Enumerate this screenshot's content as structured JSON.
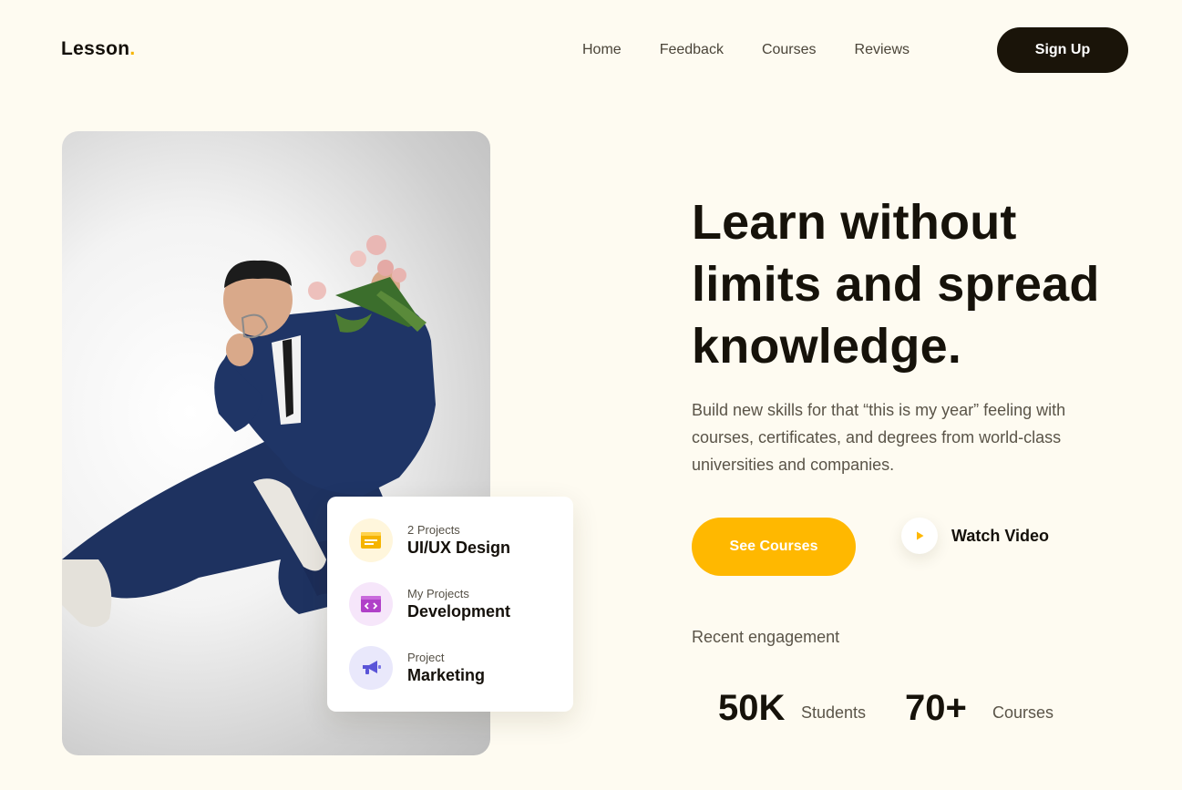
{
  "brand": {
    "name": "Lesson",
    "dot": ".",
    "accent": "#f5b400"
  },
  "nav": {
    "items": [
      "Home",
      "Feedback",
      "Courses",
      "Reviews"
    ],
    "signup_label": "Sign Up"
  },
  "card": {
    "items": [
      {
        "sub": "2 Projects",
        "main": "UI/UX Design",
        "icon": "window-icon",
        "color": "#f5b400",
        "bg": "#fff6dc"
      },
      {
        "sub": "My Projects",
        "main": "Development",
        "icon": "code-icon",
        "color": "#b040c8",
        "bg": "#f6e6fa"
      },
      {
        "sub": "Project",
        "main": "Marketing",
        "icon": "megaphone-icon",
        "color": "#5a54d8",
        "bg": "#e9e8fb"
      }
    ]
  },
  "hero": {
    "headline_1": "Learn without",
    "headline_2": "limits and spread",
    "headline_3": "knowledge.",
    "description": "Build new skills for that “this is my year” feeling with courses, certificates, and degrees from world-class universities and companies.",
    "primary_cta": "See Courses",
    "secondary_cta": "Watch Video"
  },
  "engagement": {
    "label": "Recent engagement",
    "stats": [
      {
        "value": "50K",
        "label": "Students"
      },
      {
        "value": "70+",
        "label": "Courses"
      }
    ]
  },
  "colors": {
    "primary": "#ffb800",
    "dark": "#1a1409",
    "background": "#fefbf1"
  }
}
